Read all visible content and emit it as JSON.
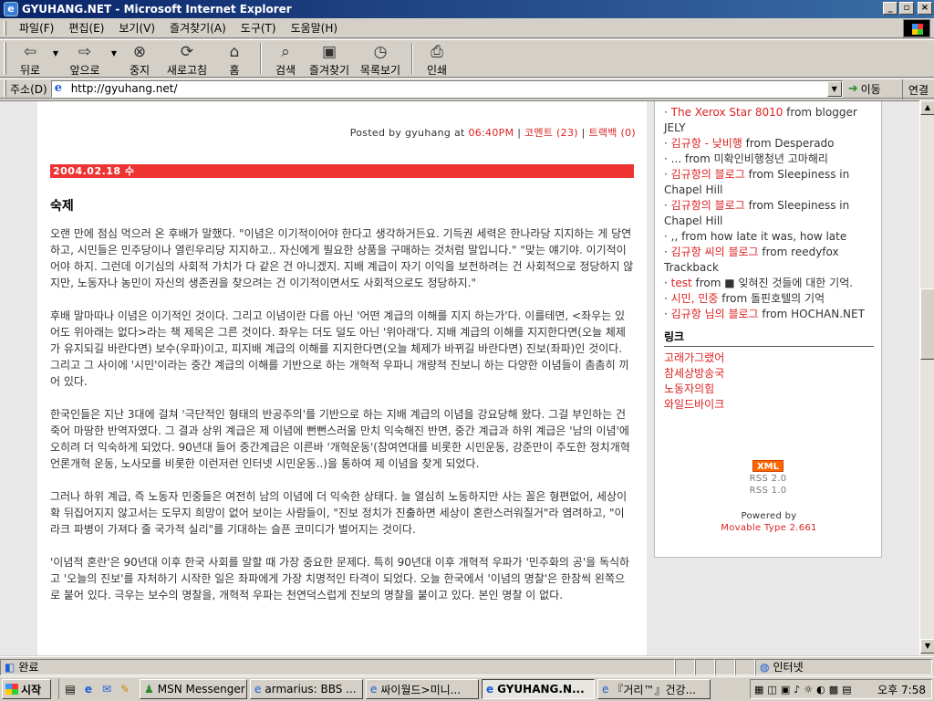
{
  "window": {
    "title": "GYUHANG.NET - Microsoft Internet Explorer",
    "buttons": [
      "_",
      "▫",
      "×"
    ]
  },
  "menu": [
    "파일(F)",
    "편집(E)",
    "보기(V)",
    "즐겨찾기(A)",
    "도구(T)",
    "도움말(H)"
  ],
  "toolbar": {
    "back": "뒤로",
    "forward": "앞으로",
    "stop": "중지",
    "refresh": "새로고침",
    "home": "홈",
    "search": "검색",
    "favorites": "즐겨찾기",
    "history": "목록보기",
    "print": "인쇄"
  },
  "address": {
    "label": "주소(D)",
    "url": "http://gyuhang.net/",
    "go": "이동",
    "links": "연결"
  },
  "post": {
    "posted_prefix": "Posted by gyuhang at",
    "time": "06:40PM",
    "comments": "코멘트 (23)",
    "trackback": "트랙백 (0)",
    "sep": "|",
    "date": "2004.02.18 수",
    "title": "숙제",
    "paragraphs": [
      "오랜 만에 점심 먹으러 온 후배가 말했다. \"이념은 이기적이어야 한다고 생각하거든요. 기득권 세력은 한나라당 지지하는 게 당연하고, 시민들은 민주당이나 열린우리당 지지하고.. 자신에게 필요한 상품을 구매하는 것처럼 말입니다.\" \"맞는 얘기야. 이기적이어야 하지. 그런데 이기심의 사회적 가치가 다 같은 건 아니겠지. 지배 계급이 자기 이익을 보전하려는 건 사회적으로 정당하지 않지만, 노동자나 농민이 자신의 생존권을 찾으려는 건 이기적이면서도 사회적으로도 정당하지.\"",
      "후배 말마따나 이념은 이기적인 것이다. 그리고 이념이란 다름 아닌 '어떤 계급의 이해를 지지 하는가'다. 이를테면, <좌우는 있어도 위아래는 없다>라는 책 제목은 그른 것이다. 좌우는 더도 덜도 아닌 '위아래'다. 지배 계급의 이해를 지지한다면(오늘 체제가 유지되길 바란다면) 보수(우파)이고, 피지배 계급의 이해를 지지한다면(오늘 체제가 바뀌길 바란다면) 진보(좌파)인 것이다. 그리고 그 사이에 '시민'이라는 중간 계급의 이해를 기반으로 하는 개혁적 우파니 개량적 진보니 하는 다양한 이념들이 촘촘히 끼어 있다.",
      "한국인들은 지난 3대에 걸쳐 '극단적인 형태의 반공주의'를 기반으로 하는 지배 계급의 이념을 강요당해 왔다. 그걸 부인하는 건 죽어 마땅한 반역자였다. 그 결과 상위 계급은 제 이념에 뻔뻔스러울 만치 익숙해진 반면, 중간 계급과 하위 계급은 '남의 이념'에 오히려 더 익숙하게 되었다. 90년대 들어 중간계급은 이른바 '개혁운동'(참여연대를 비롯한 시민운동, 강준만이 주도한 정치개혁 언론개혁 운동, 노사모를 비롯한 이런저런 인터넷 시민운동..)을 통하여 제 이념을 찾게 되었다.",
      "그러나 하위 계급, 즉 노동자 민중들은 여전히 남의 이념에 더 익숙한 상태다. 늘 열심히 노동하지만 사는 꼴은 형편없어, 세상이 확 뒤집어지지 않고서는 도무지 희망이 없어 보이는 사람들이, \"진보 정치가 진출하면 세상이 혼란스러워질거\"라 염려하고, \"이라크 파병이 가져다 줄 국가적 실리\"를 기대하는 슬픈 코미디가 벌어지는 것이다.",
      "'이념적 혼란'은 90년대 이후 한국 사회를 말할 때 가장 중요한 문제다. 특히 90년대 이후 개혁적 우파가 '민주화의 공'을 독식하고 '오늘의 진보'를 자처하기 시작한 일은 좌파에게 가장 치명적인 타격이 되었다. 오늘 한국에서 '이념의 명찰'은 한참씩 왼쪽으로 붙어 있다. 극우는 보수의 명찰을, 개혁적 우파는 천연덕스럽게 진보의 명찰을 붙이고 있다. 본인 명찰 이 없다."
    ]
  },
  "sidebar": {
    "comments": [
      {
        "who": "The Xerox Star 8010",
        "from": " from blogger JELY"
      },
      {
        "who": "김규항 - 낮비행",
        "from": " from Desperado"
      },
      {
        "who": "",
        "from": "... from 미확인비행청년 고마해리"
      },
      {
        "who": "김규항의 블로그",
        "from": " from Sleepiness in Chapel Hill"
      },
      {
        "who": "김규항의 블로그",
        "from": " from Sleepiness in Chapel Hill"
      },
      {
        "who": "",
        "from": ",, from how late it was, how late"
      },
      {
        "who": "김규항 씨의 블로그",
        "from": " from reedyfox Trackback"
      },
      {
        "who": "test",
        "from": " from ■ 잊혀진 것들에 대한 기억."
      },
      {
        "who": "시민, 민중",
        "from": " from 돌핀호텔의 기억"
      },
      {
        "who": "김규항 님의 블로그",
        "from": " from HOCHAN.NET"
      }
    ],
    "links_heading": "링크",
    "links": [
      "고래가그랬어",
      "참세상방송국",
      "노동자의힘",
      "와일드바이크"
    ],
    "xml": "XML",
    "rss20": "RSS 2.0",
    "rss10": "RSS 1.0",
    "powered_by": "Powered by",
    "engine": "Movable Type 2.661"
  },
  "status": {
    "text": "완료",
    "zone": "인터넷"
  },
  "taskbar": {
    "start": "시작",
    "tasks": [
      {
        "label": "MSN Messenger",
        "active": false
      },
      {
        "label": "armarius: BBS ...",
        "active": false
      },
      {
        "label": "싸이월드>미니...",
        "active": false
      },
      {
        "label": "GYUHANG.N...",
        "active": true
      },
      {
        "label": "『거리™』건강...",
        "active": false
      }
    ],
    "clock": "오후 7:58"
  }
}
